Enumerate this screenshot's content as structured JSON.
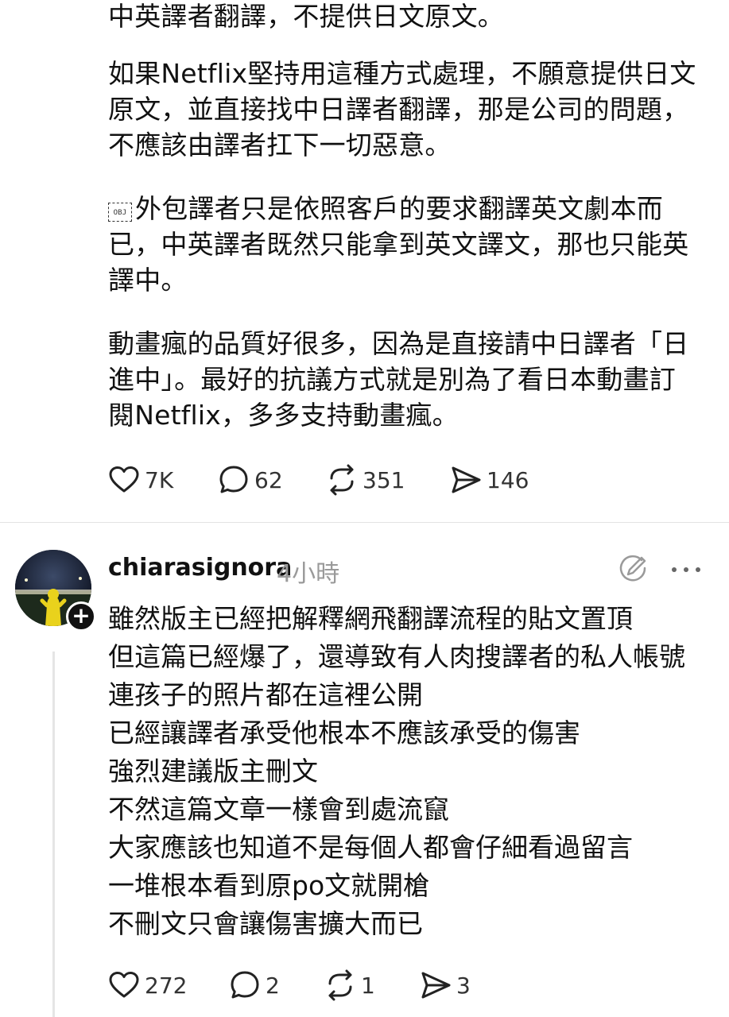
{
  "post": {
    "paragraph_0": "中英譯者翻譯，不提供日文原文。",
    "paragraph_1": [
      "如果Netflix堅持用這種方式處理，不願意提供日文",
      "原文，並直接找中日譯者翻譯，那是公司的問題，",
      "不應該由譯者扛下一切惡意。"
    ],
    "obj_glyph": "OBJ",
    "paragraph_2": [
      "外包譯者只是依照客戶的要求翻譯英文劇本而",
      "已，中英譯者既然只能拿到英文譯文，那也只能英",
      "譯中。"
    ],
    "paragraph_3": [
      "動畫瘋的品質好很多，因為是直接請中日譯者「日",
      "進中」。最好的抗議方式就是別為了看日本動畫訂",
      "閱Netflix，多多支持動畫瘋。"
    ],
    "actions": {
      "likes": "7K",
      "replies": "62",
      "reposts": "351",
      "shares": "146"
    }
  },
  "reply": {
    "username": "chiarasignora",
    "timestamp": "4小時",
    "follow_glyph": "+",
    "lines": [
      "雖然版主已經把解釋網飛翻譯流程的貼文置頂",
      "但這篇已經爆了，還導致有人肉搜譯者的私人帳號",
      "連孩子的照片都在這裡公開",
      "已經讓譯者承受他根本不應該承受的傷害",
      "強烈建議版主刪文",
      "不然這篇文章一樣會到處流竄",
      "大家應該也知道不是每個人都會仔細看過留言",
      "一堆根本看到原po文就開槍",
      "不刪文只會讓傷害擴大而已"
    ],
    "actions": {
      "likes": "272",
      "replies": "2",
      "reposts": "1",
      "shares": "3"
    }
  },
  "icons": {
    "like": "heart-icon",
    "reply": "speech-bubble-icon",
    "repost": "repost-icon",
    "share": "send-icon",
    "edit": "edit-icon",
    "more": "more-icon"
  },
  "colors": {
    "text": "#111111",
    "muted": "#9a9a9a",
    "divider": "#e3e3e3"
  }
}
